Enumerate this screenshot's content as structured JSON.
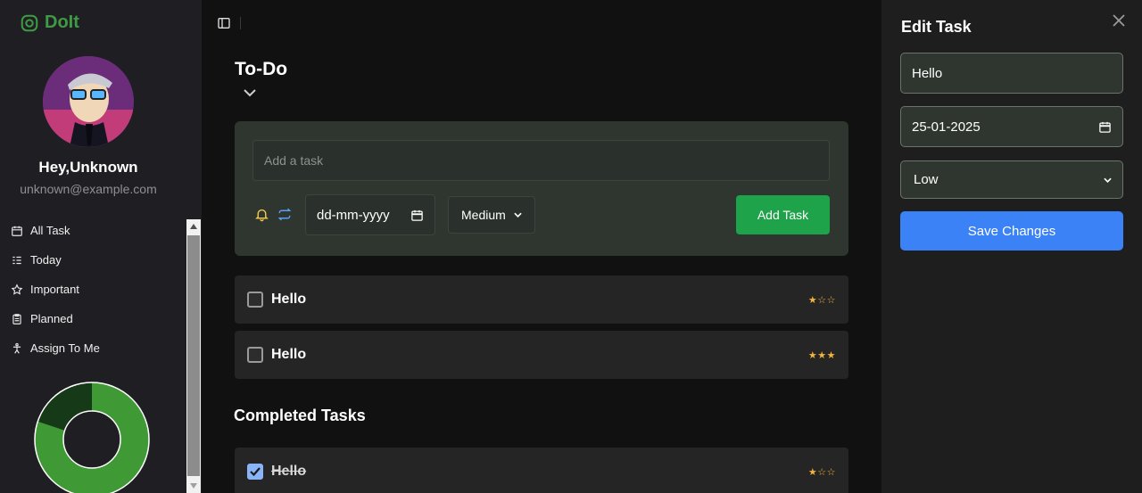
{
  "sidebar": {
    "logo_text": "DoIt",
    "greeting": "Hey,Unknown",
    "email": "unknown@example.com",
    "nav": [
      {
        "label": "All Task",
        "icon": "calendar-icon"
      },
      {
        "label": "Today",
        "icon": "list-icon"
      },
      {
        "label": "Important",
        "icon": "star-icon"
      },
      {
        "label": "Planned",
        "icon": "clipboard-icon"
      },
      {
        "label": "Assign To Me",
        "icon": "person-icon"
      }
    ],
    "progress": {
      "completed_fraction": 0.8,
      "pending_fraction": 0.2,
      "completed_color": "#3f9a35",
      "pending_color": "#163a17"
    }
  },
  "main": {
    "title": "To-Do",
    "add_task": {
      "placeholder": "Add a task",
      "date_placeholder": "dd-mm-yyyy",
      "priority": "Medium",
      "button": "Add Task"
    },
    "tasks": [
      {
        "text": "Hello",
        "stars": "★☆☆"
      },
      {
        "text": "Hello",
        "stars": "★★★"
      }
    ],
    "completed_title": "Completed Tasks",
    "completed": [
      {
        "text": "Hello",
        "stars": "★☆☆"
      }
    ]
  },
  "edit_panel": {
    "title": "Edit Task",
    "task_value": "Hello",
    "date_value": "25-01-2025",
    "priority_value": "Low",
    "save_label": "Save Changes"
  },
  "colors": {
    "accent_green": "#1fa34a",
    "accent_blue": "#3b82f6",
    "star_color": "#f2b43a"
  }
}
